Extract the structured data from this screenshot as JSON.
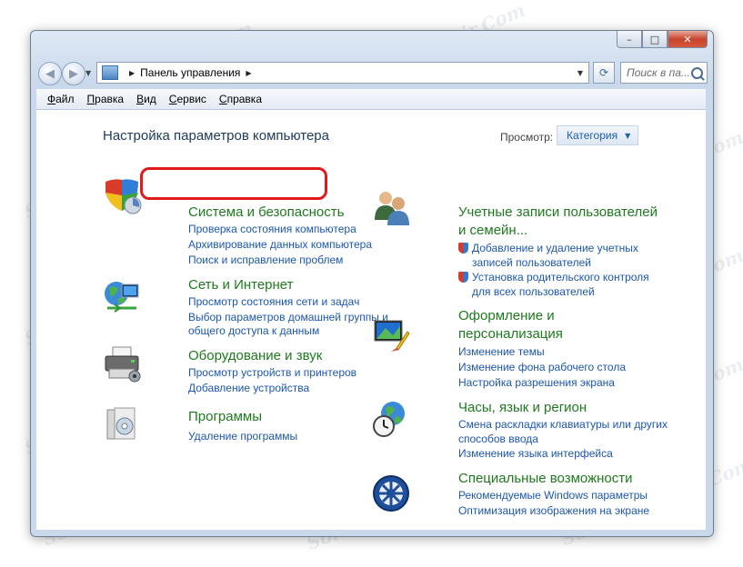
{
  "address_bar": {
    "breadcrumb": "Панель управления",
    "search_placeholder": "Поиск в па..."
  },
  "titlebar": {
    "minimize": "–",
    "maximize": "□",
    "close": "✕"
  },
  "menu": {
    "items": [
      "Файл",
      "Правка",
      "Вид",
      "Сервис",
      "Справка"
    ]
  },
  "main": {
    "page_title": "Настройка параметров компьютера",
    "view_label": "Просмотр:",
    "view_value": "Категория"
  },
  "categories_left": [
    {
      "title": "Система и безопасность",
      "icon": "shield-security-icon",
      "links": [
        "Проверка состояния компьютера",
        "Архивирование данных компьютера",
        "Поиск и исправление проблем"
      ]
    },
    {
      "title": "Сеть и Интернет",
      "icon": "network-globe-icon",
      "links": [
        "Просмотр состояния сети и задач",
        "Выбор параметров домашней группы и",
        "общего доступа к данным"
      ]
    },
    {
      "title": "Оборудование и звук",
      "icon": "printer-icon",
      "links": [
        "Просмотр устройств и принтеров",
        "Добавление устройства"
      ]
    },
    {
      "title": "Программы",
      "icon": "programs-icon",
      "links": [
        "Удаление программы"
      ]
    }
  ],
  "categories_right": [
    {
      "title_line1": "Учетные записи пользователей",
      "title_line2": "и семейн...",
      "icon": "users-icon",
      "links": [
        "Добавление и удаление учетных",
        "записей пользователей",
        "Установка родительского контроля",
        "для всех пользователей"
      ]
    },
    {
      "title_line1": "Оформление и",
      "title_line2": "персонализация",
      "icon": "personalization-icon",
      "links": [
        "Изменение темы",
        "Изменение фона рабочего стола",
        "Настройка разрешения экрана"
      ]
    },
    {
      "title": "Часы, язык и регион",
      "icon": "clock-globe-icon",
      "links": [
        "Смена раскладки клавиатуры или других",
        "способов ввода",
        "Изменение языка интерфейса"
      ]
    },
    {
      "title": "Специальные возможности",
      "icon": "accessibility-icon",
      "links": [
        "Рекомендуемые Windows параметры",
        "Оптимизация изображения на экране"
      ]
    }
  ],
  "watermark": "Soringpcrepair.Com",
  "colors": {
    "category_title": "#1f7a1f",
    "link": "#1c57b0",
    "highlight": "#e0191c"
  }
}
